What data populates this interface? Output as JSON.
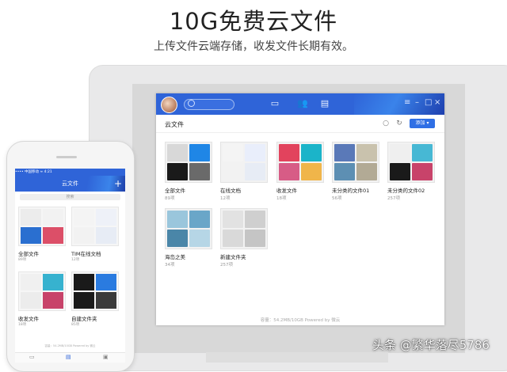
{
  "headline": "10G免费云文件",
  "subheadline": "上传文件云端存储，收发文件长期有效。",
  "desktop": {
    "toolbar_title": "云文件",
    "add_button": "添加 ▾",
    "folders": [
      {
        "name": "全部文件",
        "count": "89项",
        "colors": [
          "#d8d8d8",
          "#1f86e6",
          "#1a1a1a",
          "#6a6a6a"
        ]
      },
      {
        "name": "在线文档",
        "count": "12项",
        "colors": [
          "#f4f4f4",
          "#e9eefb",
          "#f2f2f2",
          "#e7ecf5"
        ]
      },
      {
        "name": "收发文件",
        "count": "18项",
        "colors": [
          "#e2435d",
          "#1bb4c9",
          "#d75c86",
          "#f0b54a"
        ]
      },
      {
        "name": "未分类的文件01",
        "count": "56项",
        "colors": [
          "#5a79b8",
          "#c9c2ad",
          "#5d8fb3",
          "#b2aa95"
        ]
      },
      {
        "name": "未分类的文件02",
        "count": "257项",
        "colors": [
          "#efefef",
          "#47b8d4",
          "#1a1a1a",
          "#c8436a"
        ]
      },
      {
        "name": "海岛之美",
        "count": "34项",
        "colors": [
          "#9ac6dc",
          "#6aa6c8",
          "#4a86a8",
          "#b6d6e6"
        ]
      },
      {
        "name": "新建文件夹",
        "count": "257项",
        "colors": [
          "#e2e2e2",
          "#cfcfcf",
          "#d9d9d9",
          "#c5c5c5"
        ]
      }
    ],
    "footer": "容量：54.2MB/10GB    Powered by 微云"
  },
  "phone": {
    "status": "•••• 中国移动  ≈          4:21",
    "header_title": "云文件",
    "add_icon": "+",
    "search_placeholder": "搜索",
    "folders": [
      {
        "name": "全部文件",
        "count": "89项",
        "colors": [
          "#ececec",
          "#f2f2f2",
          "#2a6fd0",
          "#dc4f68"
        ]
      },
      {
        "name": "TIM在线文档",
        "count": "12项",
        "colors": [
          "#f4f4f4",
          "#eef1f8",
          "#f2f2f2",
          "#e7ecf5"
        ]
      },
      {
        "name": "收发文件",
        "count": "18项",
        "colors": [
          "#f0f0f0",
          "#37b2cf",
          "#ececec",
          "#c8436a"
        ]
      },
      {
        "name": "自建文件夹",
        "count": "85项",
        "colors": [
          "#1a1a1a",
          "#2a7be0",
          "#1a1a1a",
          "#3a3a3a"
        ]
      }
    ],
    "footer": "容量：54.2MB/10GB    Powered by 微云"
  },
  "watermark": "头条 @繁华落尽5786"
}
